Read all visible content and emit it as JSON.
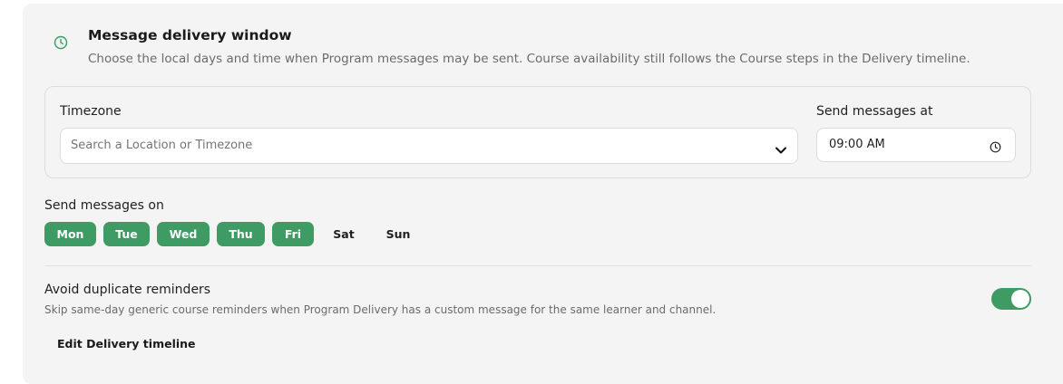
{
  "colors": {
    "accent": "#3d9b63",
    "card_bg": "#f4f4f4",
    "muted_text": "#6b6b6b"
  },
  "icons": {
    "header": "clock-icon",
    "timezone_dropdown": "chevron-down-icon",
    "time_picker": "clock-icon"
  },
  "header": {
    "title": "Message delivery window",
    "subtitle": "Choose the local days and time when Program messages may be sent. Course availability still follows the Course steps in the Delivery timeline."
  },
  "timezone": {
    "label": "Timezone",
    "placeholder": "Search a Location or Timezone",
    "value": ""
  },
  "send_time": {
    "label": "Send messages at",
    "value": "09:00 AM"
  },
  "send_days": {
    "label": "Send messages on",
    "days": [
      {
        "label": "Mon",
        "selected": true
      },
      {
        "label": "Tue",
        "selected": true
      },
      {
        "label": "Wed",
        "selected": true
      },
      {
        "label": "Thu",
        "selected": true
      },
      {
        "label": "Fri",
        "selected": true
      },
      {
        "label": "Sat",
        "selected": false
      },
      {
        "label": "Sun",
        "selected": false
      }
    ]
  },
  "avoid_duplicates": {
    "title": "Avoid duplicate reminders",
    "description": "Skip same-day generic course reminders when Program Delivery has a custom message for the same learner and channel.",
    "enabled": true
  },
  "edit_link": {
    "label": "Edit Delivery timeline"
  }
}
